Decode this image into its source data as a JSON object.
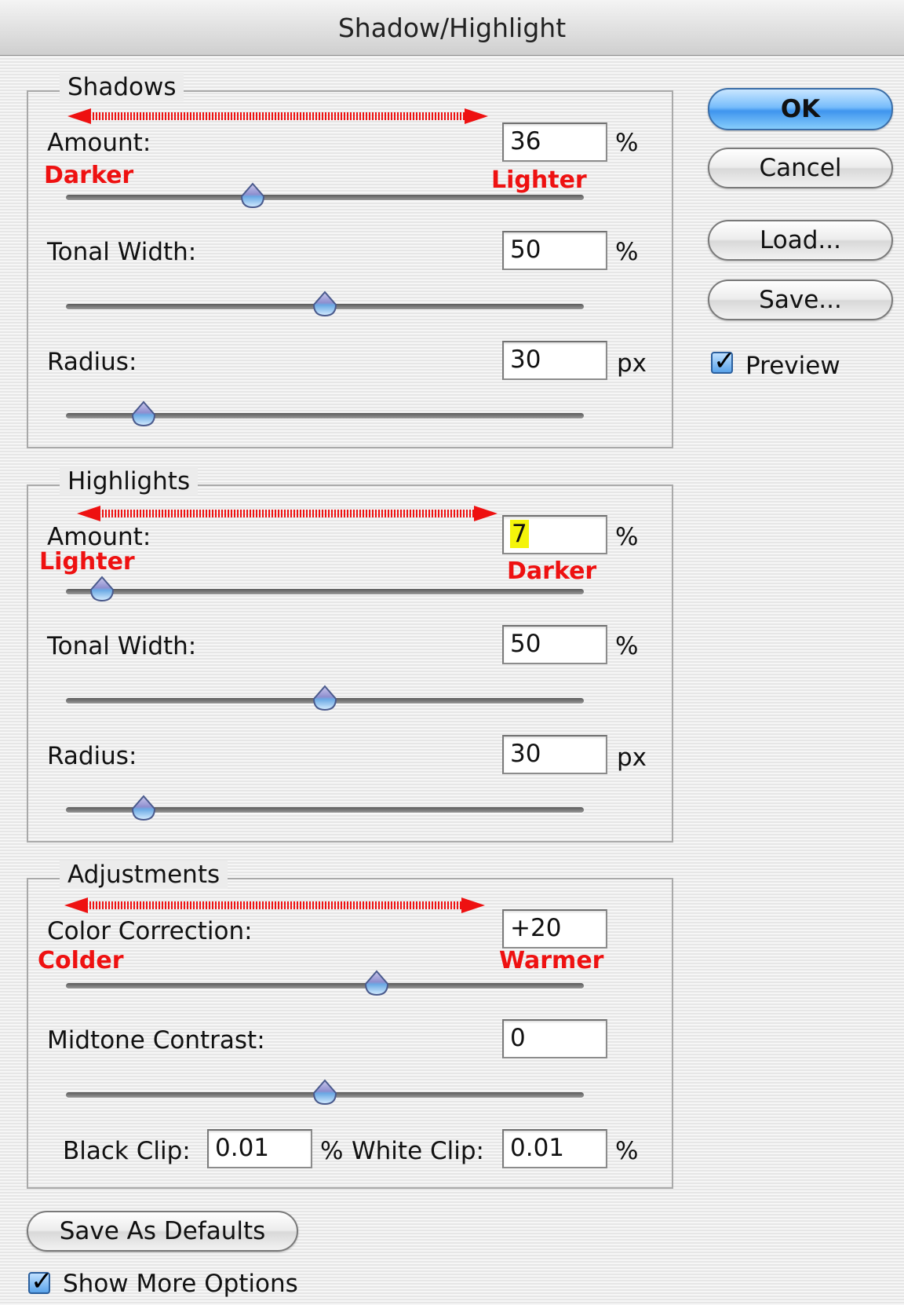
{
  "window": {
    "title": "Shadow/Highlight"
  },
  "shadows": {
    "legend": "Shadows",
    "amount": {
      "label": "Amount:",
      "value": "36",
      "unit": "%",
      "slider_fraction": 0.36
    },
    "tonal_width": {
      "label": "Tonal Width:",
      "value": "50",
      "unit": "%",
      "slider_fraction": 0.5
    },
    "radius": {
      "label": "Radius:",
      "value": "30",
      "unit": "px",
      "slider_fraction": 0.15
    }
  },
  "highlights": {
    "legend": "Highlights",
    "amount": {
      "label": "Amount:",
      "value": "7",
      "unit": "%",
      "slider_fraction": 0.07
    },
    "tonal_width": {
      "label": "Tonal Width:",
      "value": "50",
      "unit": "%",
      "slider_fraction": 0.5
    },
    "radius": {
      "label": "Radius:",
      "value": "30",
      "unit": "px",
      "slider_fraction": 0.15
    }
  },
  "adjustments": {
    "legend": "Adjustments",
    "color_correction": {
      "label": "Color Correction:",
      "value": "+20",
      "slider_fraction": 0.6
    },
    "midtone_contrast": {
      "label": "Midtone Contrast:",
      "value": "0",
      "slider_fraction": 0.5
    },
    "black_clip": {
      "label": "Black Clip:",
      "value": "0.01",
      "unit": "%"
    },
    "white_clip": {
      "label": "White Clip:",
      "value": "0.01",
      "unit": "%"
    }
  },
  "buttons": {
    "ok": "OK",
    "cancel": "Cancel",
    "load": "Load...",
    "save": "Save...",
    "save_defaults": "Save As Defaults"
  },
  "checkboxes": {
    "preview": {
      "label": "Preview",
      "checked": true
    },
    "show_more": {
      "label": "Show More Options",
      "checked": true
    }
  },
  "annotations": {
    "shadows_left": "Darker",
    "shadows_right": "Lighter",
    "highlights_left": "Lighter",
    "highlights_right": "Darker",
    "adjust_left": "Colder",
    "adjust_right": "Warmer"
  },
  "colors": {
    "annotation_red": "#ee1111",
    "highlight_yellow": "#f4f40a",
    "default_button_blue": "#3f95ee"
  },
  "icons": [
    "checkmark-icon",
    "double-arrow-icon",
    "slider-thumb-icon"
  ]
}
